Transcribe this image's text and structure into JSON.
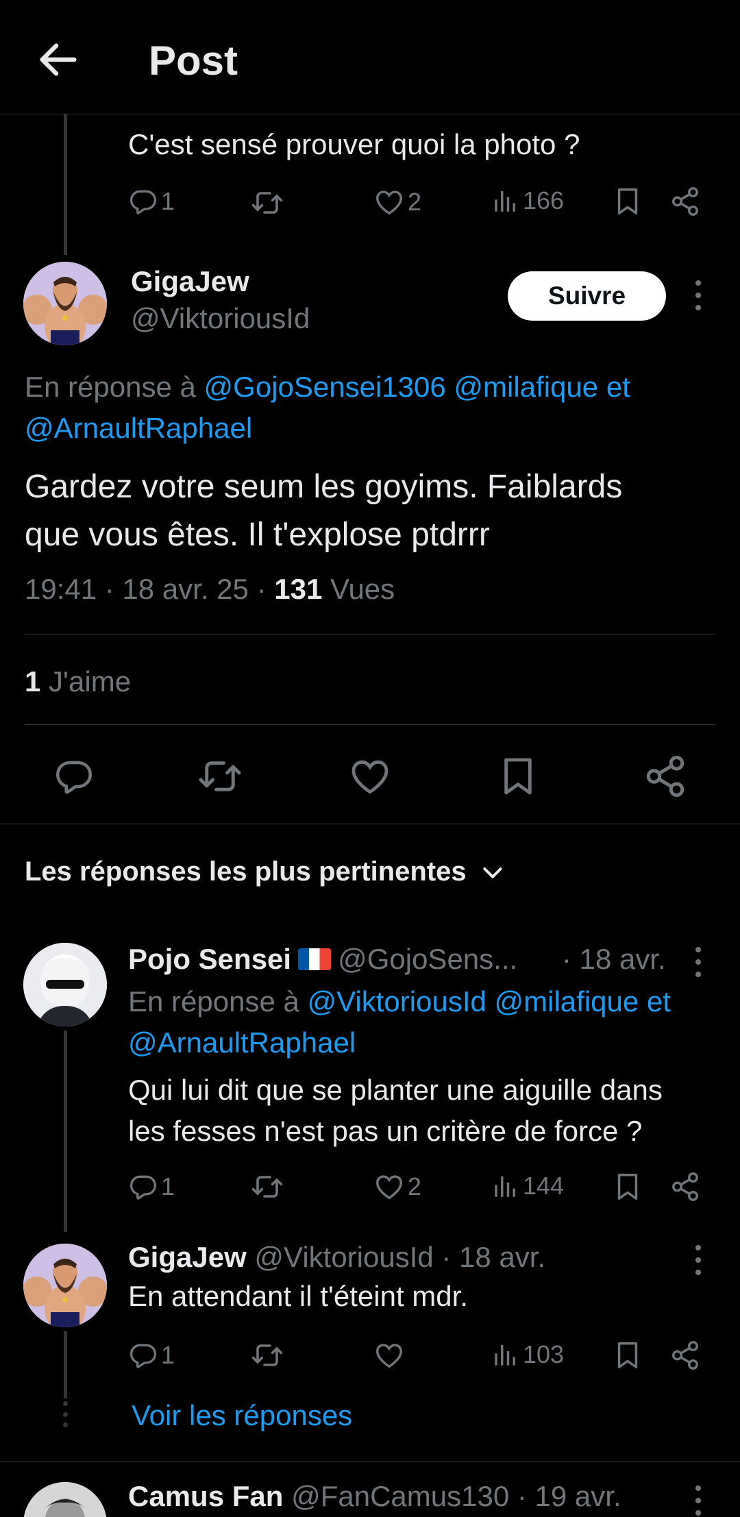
{
  "header": {
    "title": "Post"
  },
  "prev_reply": {
    "text": "C'est sensé prouver quoi la photo ?",
    "replies": "1",
    "likes": "2",
    "views": "166"
  },
  "main_post": {
    "display_name": "GigaJew",
    "handle": "@ViktoriousId",
    "follow_label": "Suivre",
    "in_reply_prefix": "En réponse à",
    "reply_to_1": "@GojoSensei1306",
    "reply_to_2": "@milafique",
    "reply_and": "et",
    "reply_to_3": "@ArnaultRaphael",
    "text_line1": "Gardez votre seum les goyims. Faiblards",
    "text_line2": "que vous êtes. Il t'explose ptdrrr",
    "time": "19:41 · 18 avr. 25 ·",
    "views_count": "131",
    "views_label": "Vues",
    "likes_count": "1",
    "likes_label": "J'aime"
  },
  "replies_sort": {
    "label": "Les réponses les plus pertinentes"
  },
  "replies": [
    {
      "display_name": "Pojo Sensei",
      "flag": "🇫🇷",
      "handle": "@GojoSens...",
      "date": "· 18 avr.",
      "in_reply_prefix": "En réponse à",
      "reply_to_1": "@ViktoriousId",
      "reply_to_2": "@milafique",
      "reply_and": "et",
      "reply_to_3": "@ArnaultRaphael",
      "text_line1": "Qui lui dit que se planter une aiguille dans",
      "text_line2": "les fesses n'est pas un critère de force ?",
      "replies": "1",
      "likes": "2",
      "views": "144"
    },
    {
      "display_name": "GigaJew",
      "handle": "@ViktoriousId",
      "date": "· 18 avr.",
      "text": "En attendant il t'éteint mdr.",
      "replies": "1",
      "likes": "",
      "views": "103"
    }
  ],
  "show_replies": {
    "label": "Voir les réponses"
  },
  "next_reply": {
    "display_name": "Camus Fan",
    "handle": "@FanCamus130",
    "date": "· 19 avr."
  },
  "colors": {
    "accent": "#1d9bf0",
    "background": "#000000",
    "muted": "#71767b",
    "text": "#e7e9ea"
  }
}
